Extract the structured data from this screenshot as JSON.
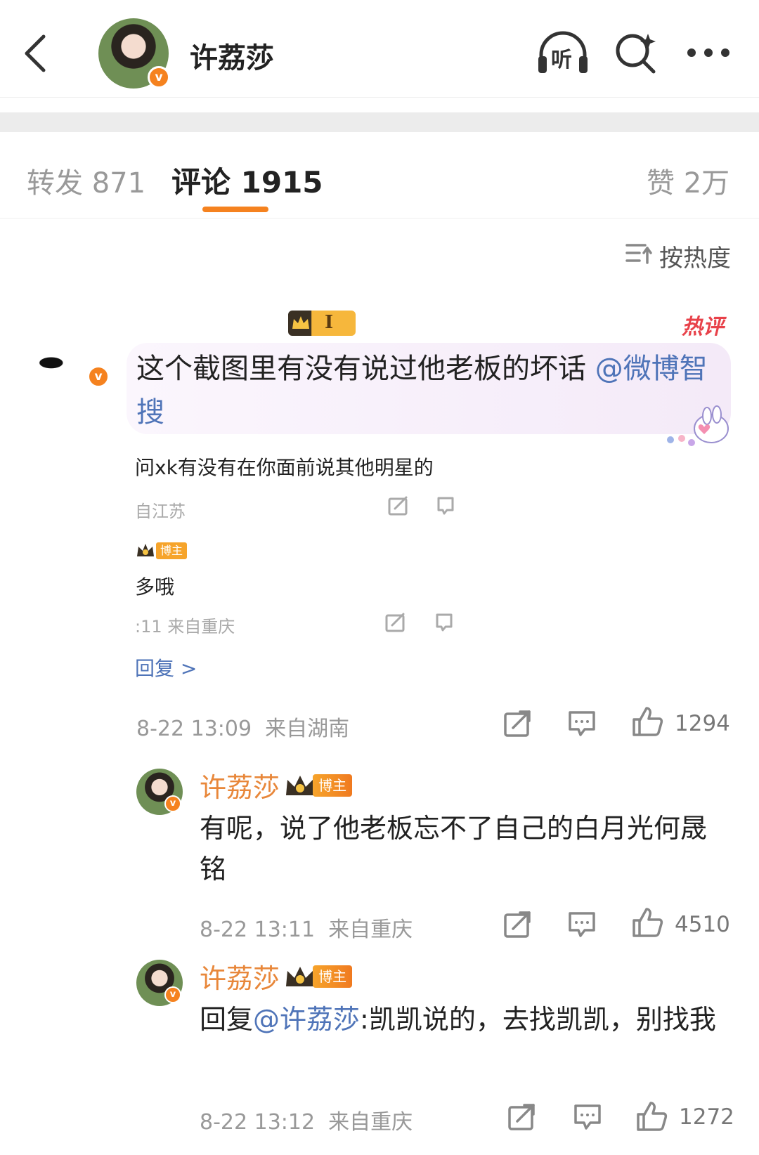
{
  "header": {
    "title": "许荔莎",
    "listen_label": "听"
  },
  "tabs": {
    "repost": "转发 871",
    "comment": "评论 1915",
    "like": "赞 2万"
  },
  "sort": {
    "label": "按热度"
  },
  "main_comment": {
    "level": "I",
    "hot_tag": "热评",
    "text_main": "这个截图里有没有说过他老板的坏话 ",
    "mention": "@微博智搜",
    "shot_line1": "问xk有没有在你面前说其他明星的",
    "shot_meta1": "自江苏",
    "shot_badge": "博主",
    "shot_line2": "多哦",
    "shot_meta2": ":11 来自重庆",
    "shot_replies": "回复 >",
    "time": "8-22 13:09  来自湖南",
    "likes": "1294"
  },
  "replies": [
    {
      "name": "许荔莎",
      "badge": "博主",
      "text": "有呢，说了他老板忘不了自己的白月光何晟铭",
      "time": "8-22 13:11  来自重庆",
      "likes": "4510"
    },
    {
      "name": "许荔莎",
      "badge": "博主",
      "prefix": "回复",
      "mention": "@许荔莎",
      "text": ":凯凯说的，去找凯凯，别找我",
      "time": "8-22 13:12  来自重庆",
      "likes": "1272"
    }
  ],
  "colors": {
    "accent": "#f5821f",
    "mention": "#4f74b8",
    "name": "#e8873a"
  }
}
